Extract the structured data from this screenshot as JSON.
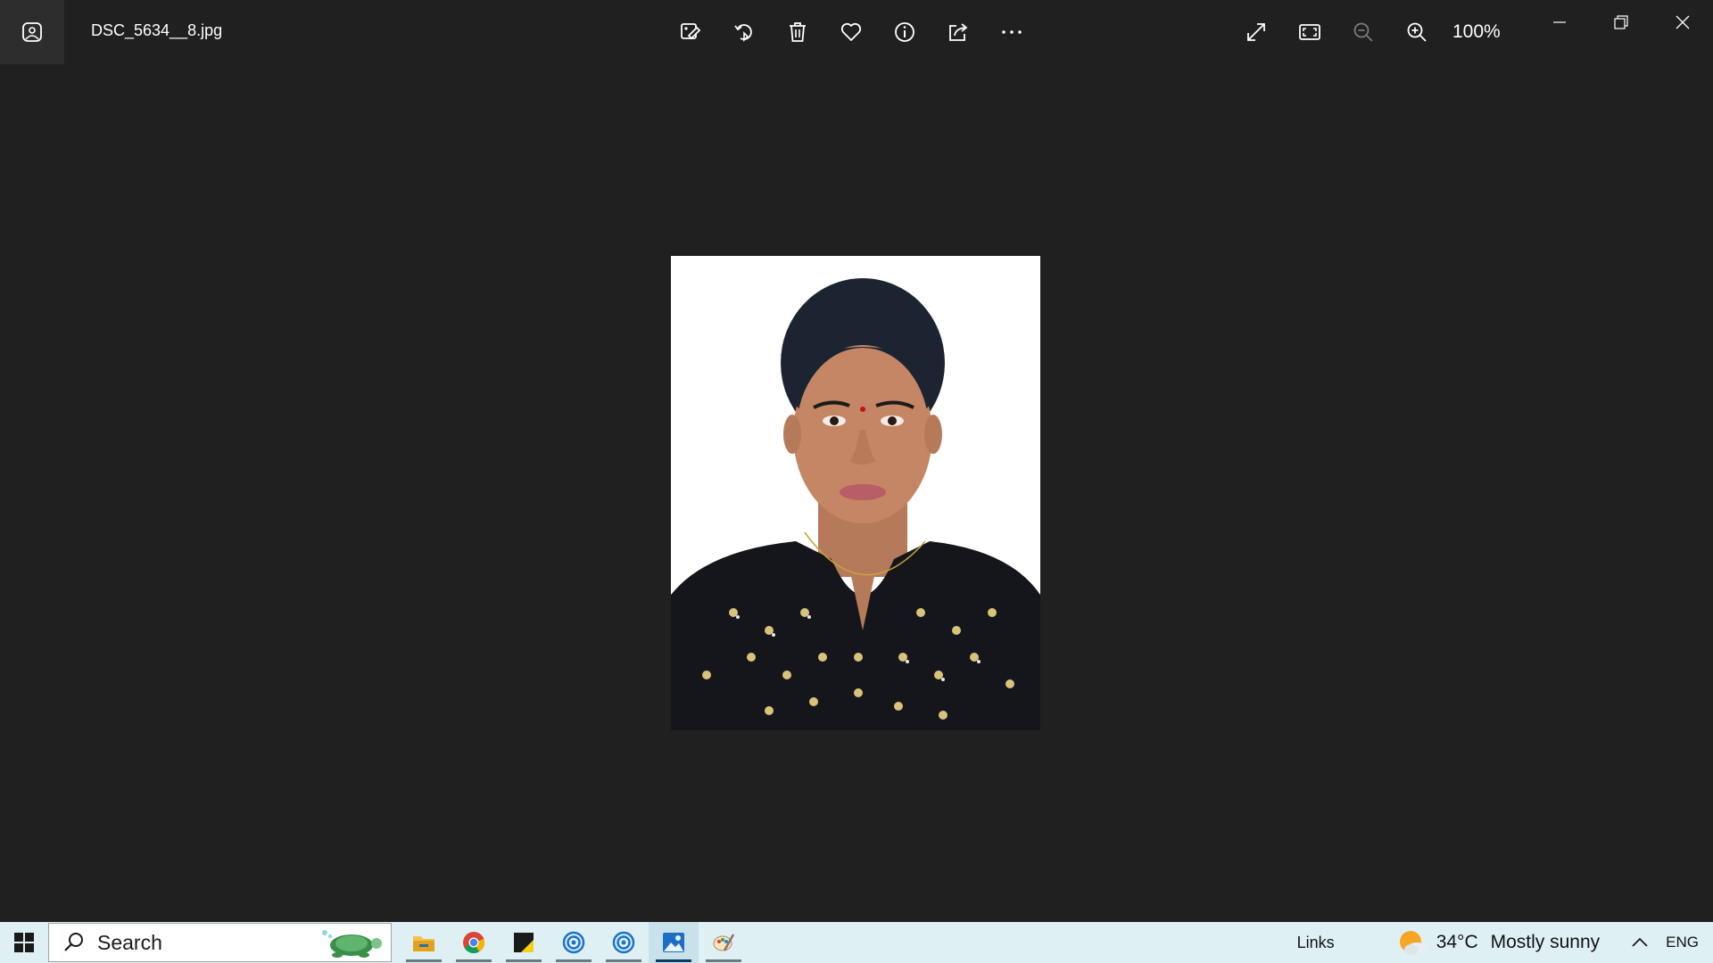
{
  "window": {
    "file_name": "DSC_5634__8.jpg",
    "zoom_level": "100%"
  },
  "toolbar": {
    "items": [
      "edit-image-icon",
      "rotate-icon",
      "delete-icon",
      "favorite-icon",
      "info-icon",
      "share-icon",
      "more-icon"
    ]
  },
  "right_tools": {
    "items": [
      "fullscreen-icon",
      "fit-window-icon",
      "zoom-out-icon",
      "zoom-in-icon"
    ]
  },
  "taskbar": {
    "search_placeholder": "Search",
    "apps": [
      "file-explorer-icon",
      "chrome-icon",
      "sticky-notes-icon",
      "edge-dev-icon",
      "edge-dev-icon",
      "photos-icon",
      "paint-icon"
    ],
    "links_label": "Links",
    "weather_temp": "34°C",
    "weather_text": "Mostly sunny",
    "language": "ENG"
  }
}
